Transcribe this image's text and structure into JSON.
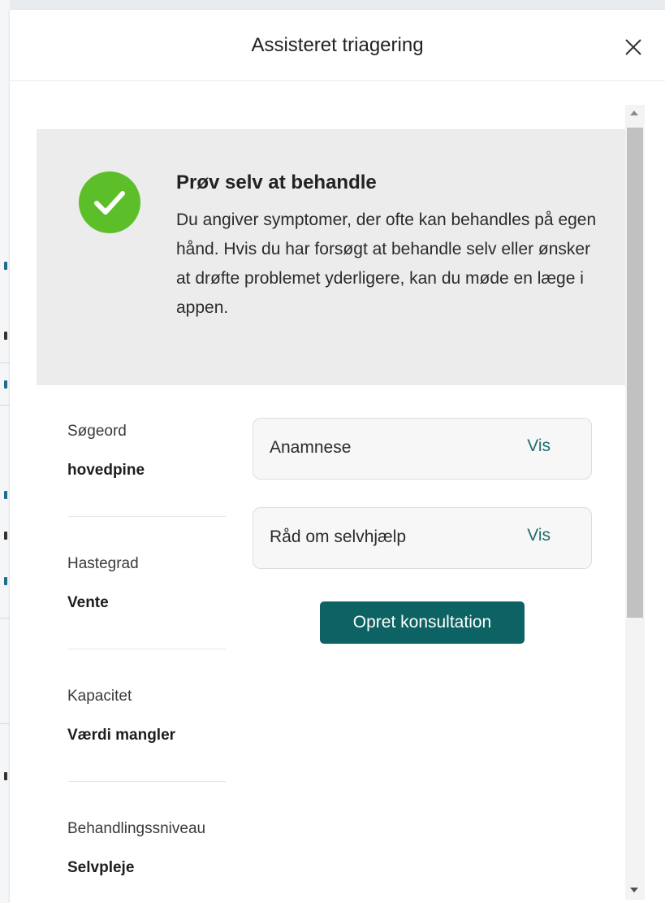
{
  "dialog": {
    "title": "Assisteret triagering",
    "close_icon": "close-icon"
  },
  "result": {
    "icon": "check-circle-icon",
    "icon_color": "#5cbf2a",
    "heading": "Prøv selv at behandle",
    "text": "Du angiver symptomer, der ofte kan behandles på egen hånd. Hvis du har forsøgt at behandle selv eller ønsker at drøfte problemet yderligere, kan du møde en læge i appen."
  },
  "fields": [
    {
      "label": "Søgeord",
      "value": "hovedpine"
    },
    {
      "label": "Hastegrad",
      "value": "Vente"
    },
    {
      "label": "Kapacitet",
      "value": "Værdi mangler"
    },
    {
      "label": "Behandlingssniveau",
      "value": "Selvpleje"
    }
  ],
  "cards": [
    {
      "label": "Anamnese",
      "action": "Vis"
    },
    {
      "label": "Råd om selvhjælp",
      "action": "Vis"
    }
  ],
  "primary_button": {
    "label": "Opret konsultation",
    "color": "#0d6363"
  },
  "colors": {
    "link": "#1f6d6d",
    "info_background": "#ececec"
  }
}
